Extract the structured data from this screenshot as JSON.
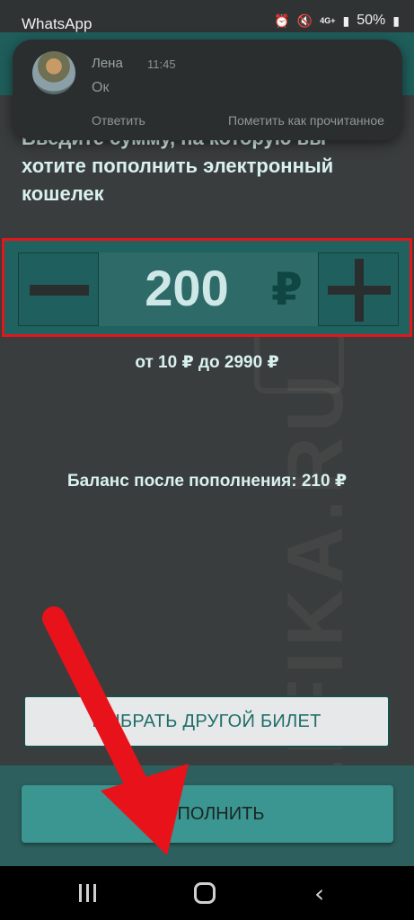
{
  "status_bar": {
    "app_name": "WhatsApp",
    "alarm_icon": "alarm-icon",
    "mute_icon": "mute-icon",
    "network": "4G+",
    "battery": "50%"
  },
  "notification": {
    "sender": "Лена",
    "time": "11:45",
    "message": "Ок",
    "reply_label": "Ответить",
    "mark_read_label": "Пометить как прочитанное"
  },
  "prompt": {
    "line1": "Введите сумму, на которую вы",
    "line2": "хотите пополнить электронный",
    "line3": "кошелек"
  },
  "amount": {
    "value": "200",
    "currency": "₽",
    "range": "от 10 ₽ до 2990 ₽"
  },
  "balance_after": "Баланс после пополнения: 210 ₽",
  "buttons": {
    "choose_other_ticket": "ВЫБРАТЬ ДРУГОЙ БИЛЕТ",
    "top_up": "ПОПОЛНИТЬ"
  },
  "watermark": "LIFIKA.RU",
  "colors": {
    "accent_teal": "#1f6260",
    "highlight_red": "#e3161b",
    "arrow_red": "#e8131a"
  },
  "nav": {
    "recent_icon": "recent-apps-icon",
    "home_icon": "home-icon",
    "back_icon": "back-icon"
  }
}
